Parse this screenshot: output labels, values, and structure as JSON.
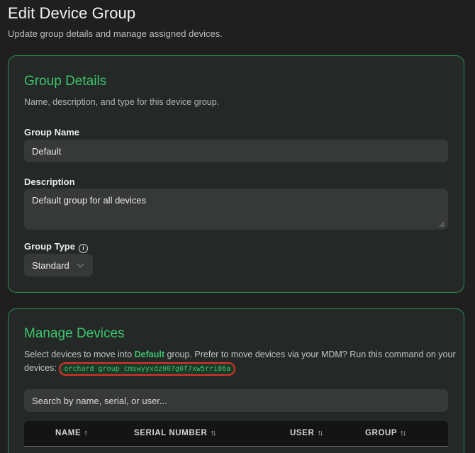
{
  "header": {
    "title": "Edit Device Group",
    "subtitle": "Update group details and manage assigned devices."
  },
  "details": {
    "title": "Group Details",
    "description": "Name, description, and type for this device group.",
    "name_label": "Group Name",
    "name_value": "Default",
    "description_label": "Description",
    "description_value": "Default group for all devices",
    "type_label": "Group Type",
    "type_info_glyph": "i",
    "type_value": "Standard"
  },
  "devices": {
    "title": "Manage Devices",
    "instructions_before": "Select devices to move into ",
    "group_name": "Default",
    "instructions_after": " group. Prefer to move devices via your MDM? Run this command on your devices: ",
    "command": "orchard group cmswyyxdz007g0f7xw5rri86a",
    "search_placeholder": "Search by name, serial, or user...",
    "columns": [
      {
        "label": "NAME",
        "sort_glyph": "↑"
      },
      {
        "label": "SERIAL NUMBER",
        "sort_glyph": "↑↓"
      },
      {
        "label": "USER",
        "sort_glyph": "↑↓"
      },
      {
        "label": "GROUP",
        "sort_glyph": "↑↓"
      }
    ]
  },
  "colors": {
    "accent": "#3ec46d",
    "card_border": "#2f8a55",
    "highlight_ring": "#e0312b",
    "background": "#1f1f1f"
  }
}
